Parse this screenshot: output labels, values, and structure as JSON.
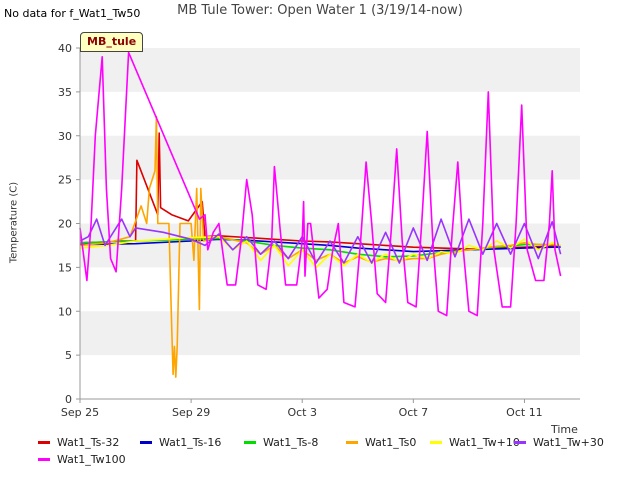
{
  "page": {
    "no_data_note": "No data for f_Wat1_Tw50",
    "title": "MB Tule Tower: Open Water 1 (3/19/14-now)",
    "badge": "MB_tule"
  },
  "chart_data": {
    "type": "line",
    "title": "MB Tule Tower: Open Water 1 (3/19/14-now)",
    "xlabel": "Time",
    "ylabel": "Temperature (C)",
    "x_ticks": [
      "Sep 25",
      "Sep 29",
      "Oct 3",
      "Oct 7",
      "Oct 11"
    ],
    "x_tick_days": [
      0,
      4,
      8,
      12,
      16
    ],
    "xlim_days": [
      0,
      18
    ],
    "ylim": [
      0,
      40
    ],
    "y_ticks": [
      0,
      5,
      10,
      15,
      20,
      25,
      30,
      35,
      40
    ],
    "grid": "horizontal bands",
    "legend_position": "bottom",
    "series": [
      {
        "name": "Wat1_Ts-32",
        "color": "#dd0000",
        "points": [
          [
            0,
            17.8
          ],
          [
            1,
            17.9
          ],
          [
            1.5,
            18.0
          ],
          [
            2,
            18.0
          ],
          [
            2.05,
            27.2
          ],
          [
            2.8,
            21.0
          ],
          [
            2.85,
            30.3
          ],
          [
            2.9,
            21.8
          ],
          [
            3.3,
            21.0
          ],
          [
            3.9,
            20.3
          ],
          [
            4.4,
            22.5
          ],
          [
            4.5,
            18.5
          ],
          [
            5,
            18.6
          ],
          [
            6,
            18.4
          ],
          [
            7,
            18.2
          ],
          [
            8,
            18.0
          ],
          [
            9,
            17.9
          ],
          [
            10,
            17.7
          ],
          [
            11,
            17.5
          ],
          [
            12,
            17.3
          ],
          [
            13,
            17.2
          ],
          [
            14,
            17.1
          ],
          [
            15,
            17.2
          ],
          [
            16,
            17.3
          ],
          [
            17,
            17.4
          ],
          [
            17.3,
            17.4
          ]
        ]
      },
      {
        "name": "Wat1_Ts-16",
        "color": "#0000cc",
        "points": [
          [
            0,
            17.6
          ],
          [
            2,
            17.7
          ],
          [
            4,
            18.0
          ],
          [
            5,
            18.2
          ],
          [
            6,
            18.1
          ],
          [
            7,
            17.9
          ],
          [
            8,
            17.7
          ],
          [
            9,
            17.5
          ],
          [
            10,
            17.2
          ],
          [
            11,
            17.0
          ],
          [
            12,
            16.8
          ],
          [
            13,
            16.9
          ],
          [
            14,
            17.0
          ],
          [
            15,
            17.1
          ],
          [
            16,
            17.2
          ],
          [
            17,
            17.3
          ],
          [
            17.3,
            17.3
          ]
        ]
      },
      {
        "name": "Wat1_Ts-8",
        "color": "#00dd00",
        "points": [
          [
            0,
            17.8
          ],
          [
            2,
            18.0
          ],
          [
            4,
            18.2
          ],
          [
            5,
            18.3
          ],
          [
            6,
            18.0
          ],
          [
            7,
            17.5
          ],
          [
            8,
            17.2
          ],
          [
            9,
            17.0
          ],
          [
            10,
            16.5
          ],
          [
            11,
            16.2
          ],
          [
            12,
            16.3
          ],
          [
            13,
            16.7
          ],
          [
            14,
            17.0
          ],
          [
            15,
            17.3
          ],
          [
            16,
            17.6
          ],
          [
            17,
            17.6
          ],
          [
            17.3,
            17.5
          ]
        ]
      },
      {
        "name": "Wat1_Ts0",
        "color": "#ffa500",
        "points": [
          [
            0,
            17.5
          ],
          [
            1,
            17.8
          ],
          [
            1.8,
            18.5
          ],
          [
            2.2,
            22.0
          ],
          [
            2.4,
            20.0
          ],
          [
            2.5,
            24.0
          ],
          [
            2.7,
            26.0
          ],
          [
            2.75,
            32.2
          ],
          [
            2.8,
            20.0
          ],
          [
            3.2,
            20.0
          ],
          [
            3.3,
            8.2
          ],
          [
            3.35,
            2.8
          ],
          [
            3.4,
            6.0
          ],
          [
            3.45,
            2.5
          ],
          [
            3.5,
            6.0
          ],
          [
            3.6,
            20.0
          ],
          [
            4.0,
            20.0
          ],
          [
            4.1,
            15.8
          ],
          [
            4.2,
            24.0
          ],
          [
            4.3,
            10.2
          ],
          [
            4.35,
            24.0
          ],
          [
            4.45,
            18.0
          ],
          [
            5,
            18.5
          ],
          [
            6,
            17.8
          ],
          [
            6.5,
            16.5
          ],
          [
            7,
            17.5
          ],
          [
            7.5,
            16.0
          ],
          [
            8,
            17.0
          ],
          [
            8.5,
            15.8
          ],
          [
            9,
            16.5
          ],
          [
            9.5,
            15.5
          ],
          [
            10,
            16.2
          ],
          [
            10.5,
            15.6
          ],
          [
            11,
            16.0
          ],
          [
            11.5,
            15.8
          ],
          [
            12,
            16.0
          ],
          [
            12.5,
            16.0
          ],
          [
            13,
            16.5
          ],
          [
            13.5,
            16.8
          ],
          [
            14,
            17.0
          ],
          [
            14.5,
            17.2
          ],
          [
            15,
            17.4
          ],
          [
            15.5,
            17.5
          ],
          [
            16,
            17.8
          ],
          [
            16.5,
            17.6
          ],
          [
            17,
            17.6
          ],
          [
            17.3,
            17.5
          ]
        ]
      },
      {
        "name": "Wat1_Tw+10",
        "color": "#ffff00",
        "points": [
          [
            0,
            17.2
          ],
          [
            1,
            17.5
          ],
          [
            2,
            18.0
          ],
          [
            3,
            18.2
          ],
          [
            4,
            18.4
          ],
          [
            5,
            18.5
          ],
          [
            5.5,
            17.0
          ],
          [
            6,
            18.0
          ],
          [
            6.5,
            15.8
          ],
          [
            7,
            17.5
          ],
          [
            7.5,
            15.2
          ],
          [
            8,
            17.0
          ],
          [
            8.5,
            15.0
          ],
          [
            9,
            16.5
          ],
          [
            9.5,
            15.2
          ],
          [
            10,
            16.5
          ],
          [
            10.5,
            15.5
          ],
          [
            11,
            16.5
          ],
          [
            11.5,
            15.6
          ],
          [
            12,
            16.5
          ],
          [
            12.5,
            16.0
          ],
          [
            13,
            16.8
          ],
          [
            13.5,
            16.5
          ],
          [
            14,
            17.5
          ],
          [
            14.5,
            17.0
          ],
          [
            15,
            18.0
          ],
          [
            15.5,
            17.2
          ],
          [
            16,
            18.2
          ],
          [
            16.5,
            17.0
          ],
          [
            17,
            17.8
          ],
          [
            17.3,
            17.5
          ]
        ]
      },
      {
        "name": "Wat1_Tw+30",
        "color": "#9933ff",
        "points": [
          [
            0,
            18.0
          ],
          [
            0.3,
            18.5
          ],
          [
            0.6,
            20.5
          ],
          [
            0.9,
            17.5
          ],
          [
            1.2,
            19.0
          ],
          [
            1.5,
            20.5
          ],
          [
            1.8,
            18.5
          ],
          [
            2.0,
            19.5
          ],
          [
            3.0,
            19.0
          ],
          [
            4.0,
            18.2
          ],
          [
            4.5,
            17.5
          ],
          [
            5,
            18.8
          ],
          [
            5.5,
            17.0
          ],
          [
            6,
            18.5
          ],
          [
            6.5,
            16.5
          ],
          [
            7,
            18.0
          ],
          [
            7.5,
            16.0
          ],
          [
            8,
            18.5
          ],
          [
            8.5,
            15.5
          ],
          [
            9,
            18.0
          ],
          [
            9.5,
            15.5
          ],
          [
            10,
            18.5
          ],
          [
            10.5,
            15.5
          ],
          [
            11,
            19.0
          ],
          [
            11.5,
            15.5
          ],
          [
            12,
            19.5
          ],
          [
            12.5,
            15.8
          ],
          [
            13,
            20.5
          ],
          [
            13.5,
            16.2
          ],
          [
            14,
            20.5
          ],
          [
            14.5,
            16.5
          ],
          [
            15,
            20.0
          ],
          [
            15.5,
            16.5
          ],
          [
            16,
            20.0
          ],
          [
            16.5,
            16.0
          ],
          [
            17,
            20.2
          ],
          [
            17.3,
            16.5
          ]
        ]
      },
      {
        "name": "Wat1_Tw100",
        "color": "#ff00ff",
        "points": [
          [
            0,
            19.5
          ],
          [
            0.25,
            13.5
          ],
          [
            0.4,
            20.0
          ],
          [
            0.55,
            30.0
          ],
          [
            0.8,
            39.0
          ],
          [
            0.95,
            24.0
          ],
          [
            1.1,
            16.0
          ],
          [
            1.3,
            14.5
          ],
          [
            1.5,
            24.0
          ],
          [
            1.75,
            39.5
          ],
          [
            4.3,
            20.5
          ],
          [
            4.5,
            21.0
          ],
          [
            4.6,
            17.0
          ],
          [
            4.8,
            19.0
          ],
          [
            5.0,
            20.0
          ],
          [
            5.3,
            13.0
          ],
          [
            5.6,
            13.0
          ],
          [
            5.8,
            18.0
          ],
          [
            6.0,
            25.0
          ],
          [
            6.2,
            21.0
          ],
          [
            6.4,
            13.0
          ],
          [
            6.7,
            12.5
          ],
          [
            6.9,
            18.0
          ],
          [
            7.0,
            26.5
          ],
          [
            7.2,
            19.5
          ],
          [
            7.4,
            13.0
          ],
          [
            7.8,
            13.0
          ],
          [
            8.0,
            18.0
          ],
          [
            8.05,
            22.5
          ],
          [
            8.1,
            14.0
          ],
          [
            8.2,
            20.0
          ],
          [
            8.3,
            20.0
          ],
          [
            8.6,
            11.5
          ],
          [
            8.9,
            12.5
          ],
          [
            9.1,
            17.0
          ],
          [
            9.3,
            20.0
          ],
          [
            9.5,
            11.0
          ],
          [
            9.9,
            10.5
          ],
          [
            10.1,
            18.0
          ],
          [
            10.3,
            27.0
          ],
          [
            10.5,
            20.0
          ],
          [
            10.7,
            12.0
          ],
          [
            11.0,
            11.0
          ],
          [
            11.2,
            19.0
          ],
          [
            11.4,
            28.5
          ],
          [
            11.6,
            18.0
          ],
          [
            11.8,
            11.0
          ],
          [
            12.1,
            10.5
          ],
          [
            12.3,
            20.0
          ],
          [
            12.5,
            30.5
          ],
          [
            12.7,
            18.0
          ],
          [
            12.9,
            10.0
          ],
          [
            13.2,
            9.5
          ],
          [
            13.4,
            19.0
          ],
          [
            13.6,
            27.0
          ],
          [
            13.8,
            17.0
          ],
          [
            14.0,
            10.0
          ],
          [
            14.3,
            9.5
          ],
          [
            14.5,
            20.0
          ],
          [
            14.7,
            35.0
          ],
          [
            14.9,
            17.0
          ],
          [
            15.2,
            10.5
          ],
          [
            15.5,
            10.5
          ],
          [
            15.7,
            20.0
          ],
          [
            15.9,
            33.5
          ],
          [
            16.1,
            17.0
          ],
          [
            16.4,
            13.5
          ],
          [
            16.7,
            13.5
          ],
          [
            16.9,
            20.0
          ],
          [
            17.0,
            26.0
          ],
          [
            17.1,
            17.0
          ],
          [
            17.3,
            14.0
          ]
        ]
      }
    ]
  }
}
